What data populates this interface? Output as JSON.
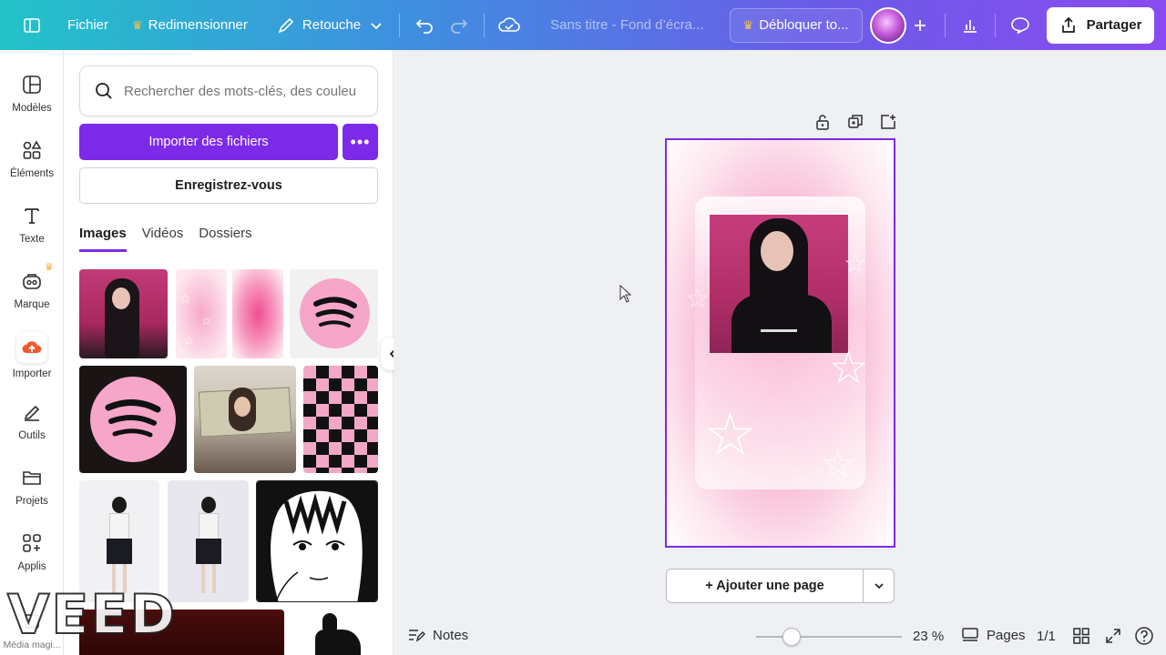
{
  "topbar": {
    "file_label": "Fichier",
    "resize_label": "Redimensionner",
    "retouch_label": "Retouche",
    "doc_title": "Sans titre - Fond d’écra...",
    "unlock_label": "Débloquer to...",
    "share_label": "Partager",
    "brand_gradient": [
      "#22c3c9",
      "#3f8fe0",
      "#6a5ce8",
      "#8a4bf0"
    ]
  },
  "leftnav": {
    "items": [
      {
        "label": "Modèles",
        "icon": "templates-icon"
      },
      {
        "label": "Éléments",
        "icon": "elements-icon"
      },
      {
        "label": "Texte",
        "icon": "text-icon"
      },
      {
        "label": "Marque",
        "icon": "brand-icon"
      },
      {
        "label": "Importer",
        "icon": "upload-icon"
      },
      {
        "label": "Outils",
        "icon": "tools-icon"
      },
      {
        "label": "Projets",
        "icon": "folder-icon"
      },
      {
        "label": "Applis",
        "icon": "apps-icon"
      },
      {
        "label": "Média magi...",
        "icon": "magic-media-icon"
      }
    ]
  },
  "panel": {
    "search_placeholder": "Rechercher des mots-clés, des couleu",
    "import_label": "Importer des fichiers",
    "register_label": "Enregistrez-vous",
    "tabs": [
      "Images",
      "Vidéos",
      "Dossiers"
    ],
    "active_tab": "Images"
  },
  "canvas": {
    "add_page_label": "+ Ajouter une page",
    "accent": "#7d2ae8"
  },
  "bottombar": {
    "notes_label": "Notes",
    "zoom": "23 %",
    "pages_label": "Pages",
    "page_count": "1/1"
  },
  "watermark": "VEED"
}
